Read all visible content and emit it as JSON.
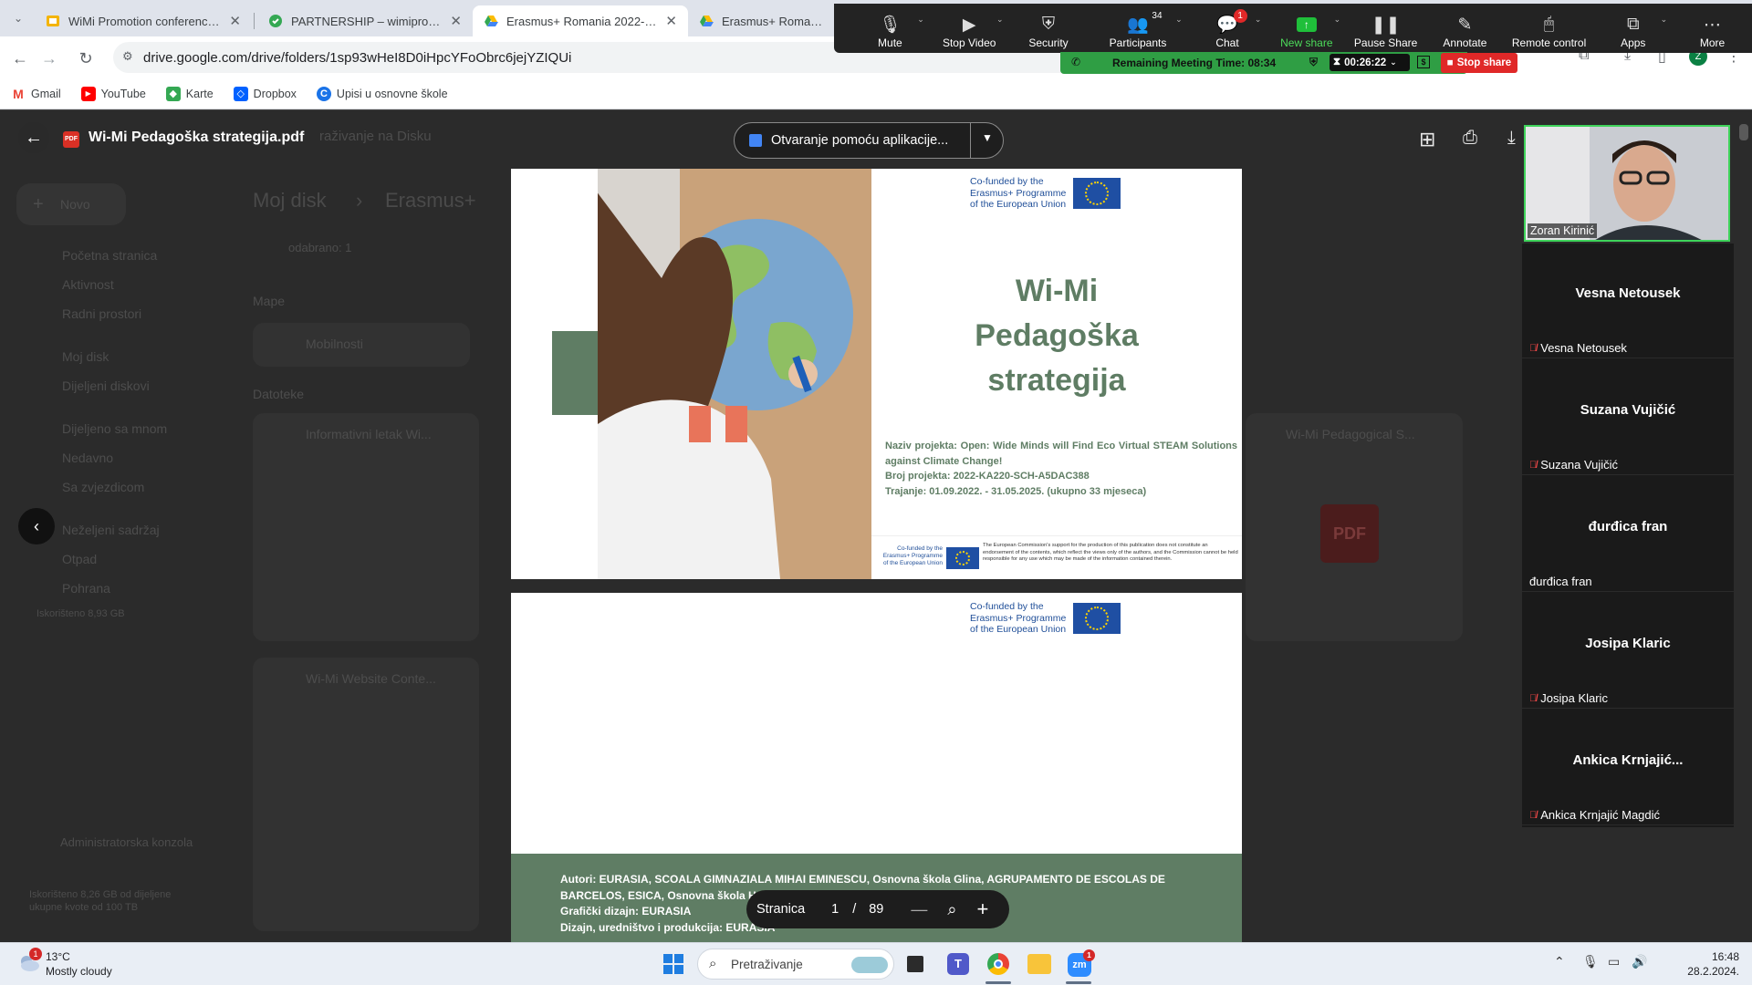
{
  "browser": {
    "tabs": [
      {
        "title": "WiMi Promotion conference - G",
        "icon": "slides-icon",
        "color": "#f4b400"
      },
      {
        "title": "PARTNERSHIP – wimiproject",
        "icon": "site-icon",
        "color": "#34a853"
      },
      {
        "title": "Erasmus+ Romania 2022-2025",
        "icon": "drive-icon",
        "color": "#4285f4"
      },
      {
        "title": "Erasmus+ Romania 2022",
        "icon": "drive-icon",
        "color": "#4285f4"
      }
    ],
    "url": "drive.google.com/drive/folders/1sp93wHeI8D0iHpcYFoObrc6jejYZIQUi",
    "bookmarks": [
      "Gmail",
      "YouTube",
      "Karte",
      "Dropbox",
      "Upisi u osnovne škole"
    ]
  },
  "zoom": {
    "buttons": [
      {
        "label": "Mute",
        "icon": "microphone-icon"
      },
      {
        "label": "Stop Video",
        "icon": "video-camera-icon"
      },
      {
        "label": "Security",
        "icon": "shield-icon"
      },
      {
        "label": "Participants",
        "icon": "participants-icon",
        "badge": "34"
      },
      {
        "label": "Chat",
        "icon": "chat-icon",
        "badge": "1"
      },
      {
        "label": "New share",
        "icon": "share-screen-icon"
      },
      {
        "label": "Pause Share",
        "icon": "pause-icon"
      },
      {
        "label": "Annotate",
        "icon": "pencil-icon"
      },
      {
        "label": "Remote control",
        "icon": "mouse-icon"
      },
      {
        "label": "Apps",
        "icon": "apps-icon"
      },
      {
        "label": "More",
        "icon": "more-icon"
      }
    ],
    "remaining_time": "Remaining Meeting Time: 08:34",
    "elapsed": "00:26:22",
    "stop_share": "Stop share"
  },
  "drive": {
    "new_button": "Novo",
    "nav": [
      "Početna stranica",
      "Aktivnost",
      "Radni prostori",
      "Moj disk",
      "Dijeljeni diskovi",
      "Dijeljeno sa mnom",
      "Nedavno",
      "Sa zvjezdicom",
      "Neželjeni sadržaj",
      "Otpad",
      "Pohrana"
    ],
    "storage_text": "Iskorišteno 8,93 GB",
    "admin": "Administratorska konzola",
    "storage2_line1": "Iskorišteno 8,26 GB od dijeljene",
    "storage2_line2": "ukupne kvote od 100 TB",
    "breadcrumb_1": "Moj disk",
    "breadcrumb_2": "Erasmus+",
    "selected": "odabrano: 1",
    "section_folders": "Mape",
    "folder_1": "Mobilnosti",
    "section_files": "Datoteke",
    "file_1": "Informativni letak Wi...",
    "file_2": "Wi-Mi Website Conte...",
    "file_3": "Wi-Mi Pedagogical S...",
    "behind_header": "raživanje na Disku",
    "pdf_label": "PDF"
  },
  "viewer": {
    "file_title": "Wi-Mi Pedagoška strategija.pdf",
    "open_with": "Otvaranje pomoću aplikacije...",
    "page_label": "Stranica",
    "page_current": "1",
    "page_sep": "/",
    "page_total": "89"
  },
  "pdf": {
    "eu_line1": "Co-funded by the",
    "eu_line2": "Erasmus+ Programme",
    "eu_line3": "of the European Union",
    "title_1": "Wi-Mi",
    "title_2": "Pedagoška",
    "title_3": "strategija",
    "naziv": "Naziv projekta: Open: Wide Minds will Find Eco Virtual STEAM Solutions against Climate Change!",
    "broj": "Broj projekta: 2022-KA220-SCH-A5DAC388",
    "trajanje": "Trajanje: 01.09.2022. - 31.05.2025. (ukupno 33 mjeseca)",
    "disclaimer": "The European Commission's support for the production of this publication does not constitute an endorsement of the contents, which reflect the views only of the authors, and the Commission cannot be held responsible for any use which may be made of the information contained therein.",
    "autori": "Autori: EURASIA, SCOALA GIMNAZIALA MIHAI EMINESCU, Osnovna škola Glina, AGRUPAMENTO DE ESCOLAS DE BARCELOS, ESICA, Osnovna škola Hristo Smirnenski",
    "graficki": "Grafički dizajn: EURASIA",
    "dizajn": "Dizajn, uredništvo i produkcija: EURASIA",
    "green": "#5f7d64"
  },
  "participants": {
    "video_name": "Zoran Kirinić",
    "tiles": [
      {
        "big": "Vesna Netousek",
        "small": "Vesna Netousek",
        "muted": true
      },
      {
        "big": "Suzana Vujičić",
        "small": "Suzana Vujičić",
        "muted": true
      },
      {
        "big": "đurđica fran",
        "small": "đurđica fran",
        "muted": false
      },
      {
        "big": "Josipa Klaric",
        "small": "Josipa Klaric",
        "muted": true
      },
      {
        "big": "Ankica  Krnjajić...",
        "small": "Ankica Krnjajić Magdić",
        "muted": true
      }
    ]
  },
  "taskbar": {
    "weather_temp": "13°C",
    "weather_desc": "Mostly cloudy",
    "weather_badge": "1",
    "search": "Pretraživanje",
    "time": "16:48",
    "date": "28.2.2024.",
    "zoom_badge": "1"
  }
}
